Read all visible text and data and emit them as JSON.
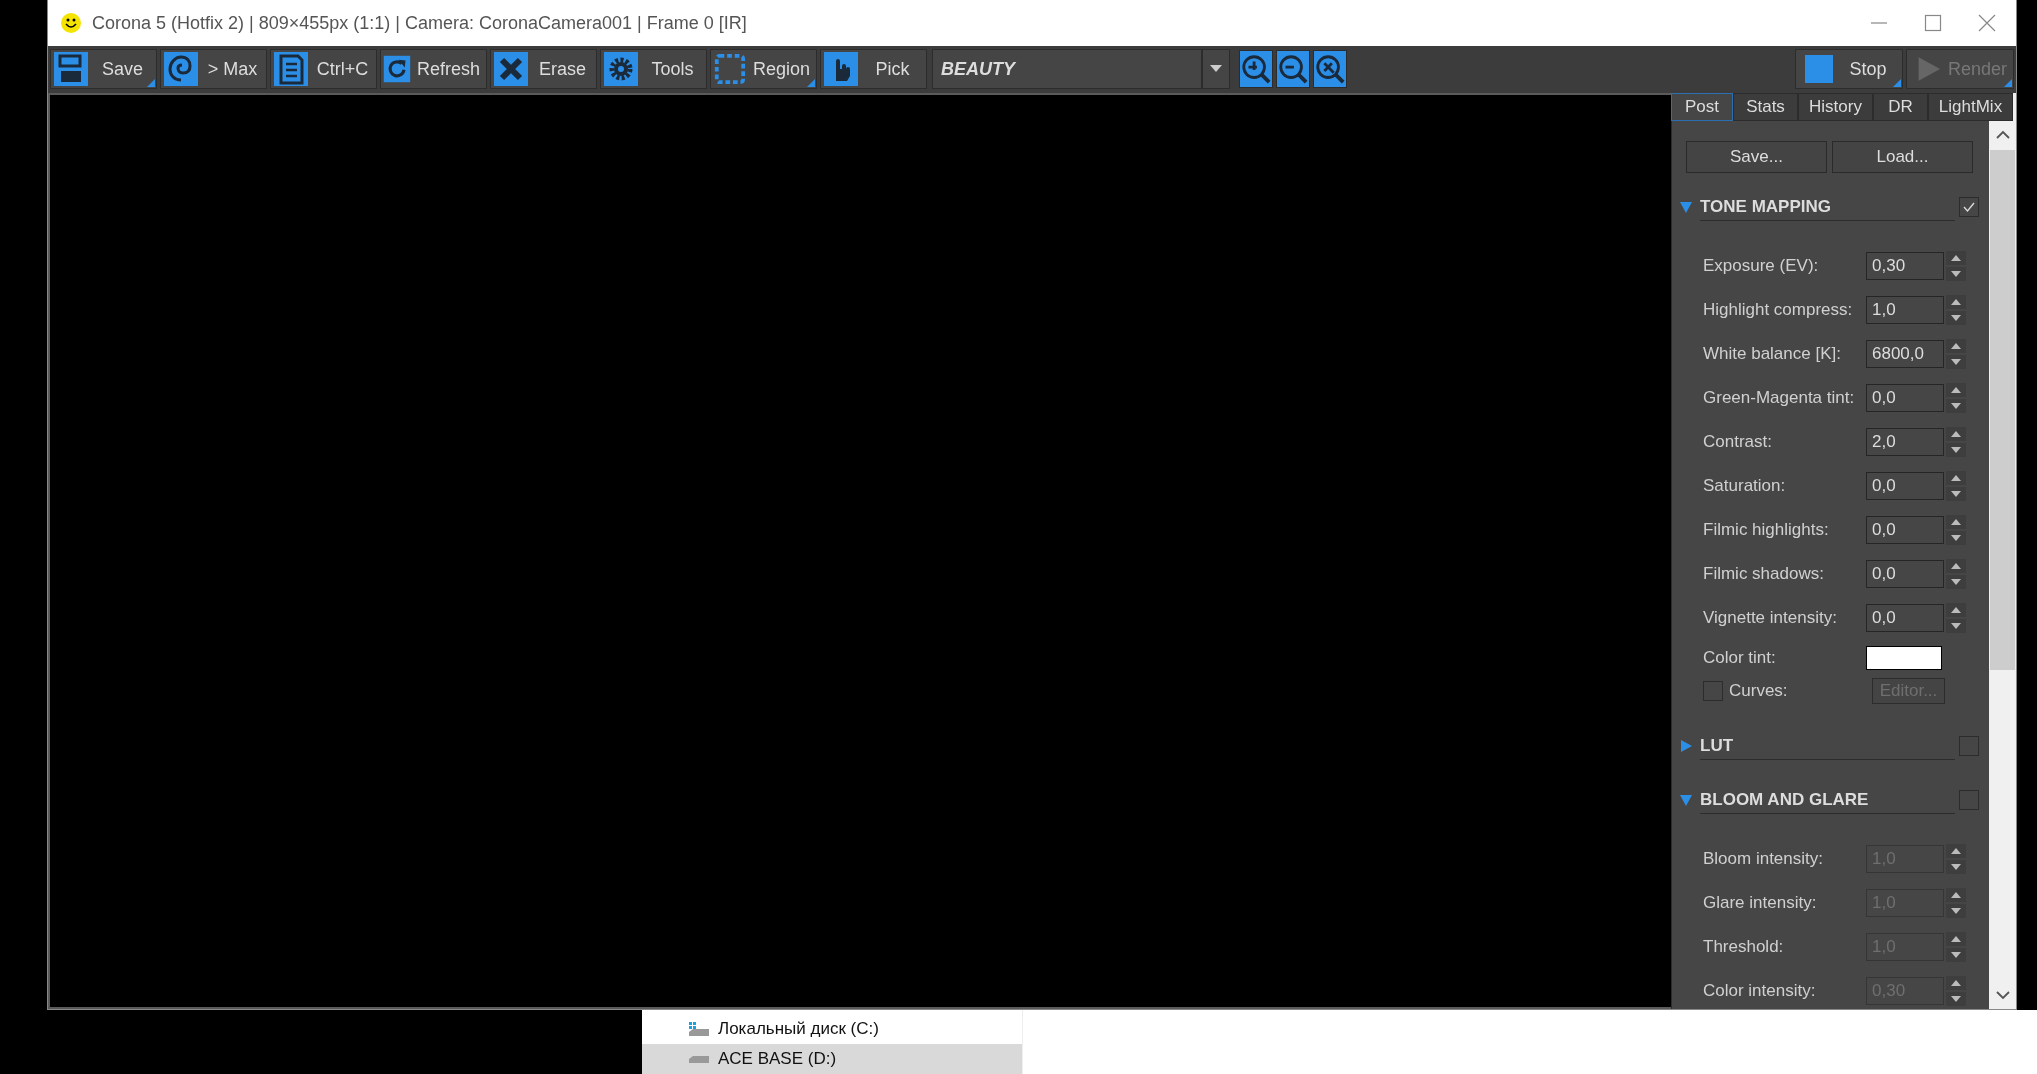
{
  "window": {
    "title": "Corona 5 (Hotfix 2) | 809×455px (1:1) | Camera: CoronaCamera001 | Frame 0 [IR]"
  },
  "toolbar": {
    "buttons": [
      {
        "label": "Save",
        "menu": true
      },
      {
        "label": "> Max",
        "menu": false
      },
      {
        "label": "Ctrl+C",
        "menu": false
      },
      {
        "label": "Refresh",
        "menu": false
      },
      {
        "label": "Erase",
        "menu": false
      },
      {
        "label": "Tools",
        "menu": false
      },
      {
        "label": "Region",
        "menu": true
      },
      {
        "label": "Pick",
        "menu": false
      }
    ],
    "pass_selector": {
      "value": "BEAUTY"
    },
    "render_controls": [
      {
        "label": "Stop",
        "menu": true,
        "disabled": false
      },
      {
        "label": "Render",
        "menu": true,
        "disabled": true
      }
    ]
  },
  "panel": {
    "tabs": [
      {
        "label": "Post",
        "selected": true
      },
      {
        "label": "Stats",
        "selected": false
      },
      {
        "label": "History",
        "selected": false
      },
      {
        "label": "DR",
        "selected": false
      },
      {
        "label": "LightMix",
        "selected": false
      }
    ],
    "buttons": [
      "Save...",
      "Load..."
    ],
    "sections": [
      {
        "title": "TONE MAPPING",
        "expanded": true,
        "checked": true,
        "rows": [
          {
            "kind": "spinner",
            "label": "Exposure (EV):",
            "value": "0,30",
            "disabled": false
          },
          {
            "kind": "spinner",
            "label": "Highlight compress:",
            "value": "1,0",
            "disabled": false
          },
          {
            "kind": "spinner",
            "label": "White balance [K]:",
            "value": "6800,0",
            "disabled": false
          },
          {
            "kind": "spinner",
            "label": "Green-Magenta tint:",
            "value": "0,0",
            "disabled": false
          },
          {
            "kind": "spinner",
            "label": "Contrast:",
            "value": "2,0",
            "disabled": false
          },
          {
            "kind": "spinner",
            "label": "Saturation:",
            "value": "0,0",
            "disabled": false
          },
          {
            "kind": "spinner",
            "label": "Filmic highlights:",
            "value": "0,0",
            "disabled": false
          },
          {
            "kind": "spinner",
            "label": "Filmic shadows:",
            "value": "0,0",
            "disabled": false
          },
          {
            "kind": "spinner",
            "label": "Vignette intensity:",
            "value": "0,0",
            "disabled": false
          },
          {
            "kind": "color",
            "label": "Color tint:",
            "color": "#ffffff"
          },
          {
            "kind": "checkbox",
            "label": "Curves:",
            "checked": false,
            "button": "Editor...",
            "disabled": true
          }
        ]
      },
      {
        "title": "LUT",
        "expanded": false,
        "checked": false
      },
      {
        "title": "BLOOM AND GLARE",
        "expanded": true,
        "checked": false,
        "rows": [
          {
            "kind": "spinner",
            "label": "Bloom intensity:",
            "value": "1,0",
            "disabled": true
          },
          {
            "kind": "spinner",
            "label": "Glare intensity:",
            "value": "1,0",
            "disabled": true
          },
          {
            "kind": "spinner",
            "label": "Threshold:",
            "value": "1,0",
            "disabled": true
          },
          {
            "kind": "spinner",
            "label": "Color intensity:",
            "value": "0,30",
            "disabled": true
          }
        ]
      }
    ]
  },
  "explorer": {
    "items": [
      {
        "label": "Локальный диск (C:)",
        "selected": false
      },
      {
        "label": "ACE BASE (D:)",
        "selected": true
      }
    ]
  }
}
